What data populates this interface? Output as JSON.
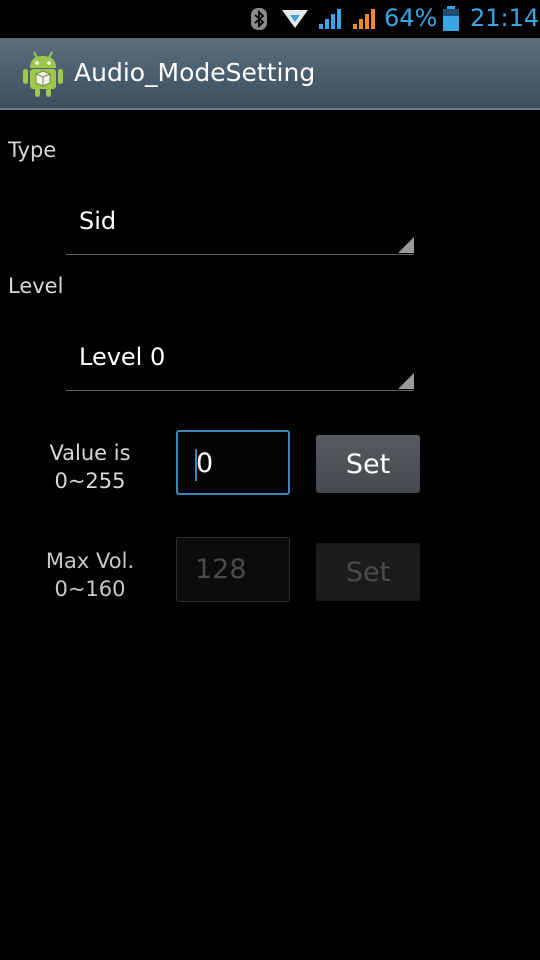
{
  "status_bar": {
    "battery_percent": "64%",
    "time": "21:14",
    "icons": [
      "bluetooth-icon",
      "notification-icon",
      "signal-icon-1",
      "signal-icon-2",
      "battery-icon"
    ],
    "accent_color": "#38a5e6"
  },
  "title_bar": {
    "title": "Audio_ModeSetting",
    "icon": "android-robot-icon"
  },
  "type_section": {
    "label": "Type",
    "selected": "Sid"
  },
  "level_section": {
    "label": "Level",
    "selected": "Level 0"
  },
  "value_row": {
    "label_line1": "Value is",
    "label_line2": "0~255",
    "value": "0",
    "button_label": "Set"
  },
  "maxvol_row": {
    "label_line1": "Max Vol.",
    "label_line2": "0~160",
    "value": "128",
    "button_label": "Set"
  }
}
